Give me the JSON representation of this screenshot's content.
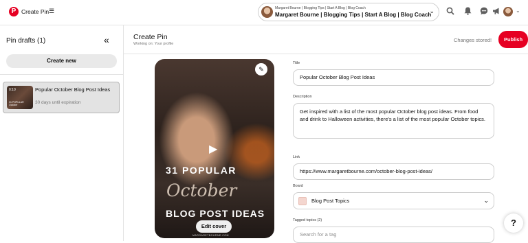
{
  "topbar": {
    "app_title": "Create Pin",
    "profile_line1": "Margaret Bourne | Blogging Tips | Start A Blog | Blog Coach",
    "profile_line2": "Margaret Bourne | Blogging Tips | Start A Blog | Blog Coach",
    "icons": [
      "pinterest-logo-icon",
      "menu-icon",
      "chevron-down-icon",
      "search-icon",
      "bell-icon",
      "chat-icon",
      "megaphone-icon",
      "avatar",
      "chevron-down-icon"
    ]
  },
  "sidebar": {
    "title": "Pin drafts",
    "count": "(1)",
    "create_new": "Create new",
    "draft": {
      "duration": "0:10",
      "title": "Popular October Blog Post Ideas",
      "subtitle": "30 days until expiration"
    }
  },
  "main": {
    "title": "Create Pin",
    "subtitle": "Working on: Your profile",
    "status": "Changes stored!",
    "publish": "Publish"
  },
  "preview": {
    "line1": "31 POPULAR",
    "line2": "October",
    "line3": "BLOG POST IDEAS",
    "edit_cover": "Edit cover",
    "url": "MARGARETBOURNE.COM"
  },
  "form": {
    "title_label": "Title",
    "title_value": "Popular October Blog Post Ideas",
    "description_label": "Description",
    "description_value": "Get inspired with a list of the most popular October blog post ideas. From food and drink to Halloween activities, there's a list of the most popular October topics.",
    "link_label": "Link",
    "link_value": "https://www.margaretbourne.com/october-blog-post-ideas/",
    "board_label": "Board",
    "board_value": "Blog Post Topics",
    "tags_label": "Tagged topics (2)",
    "tags_placeholder": "Search for a tag"
  },
  "help": "?",
  "colors": {
    "brand": "#e60023",
    "border": "#cdcdcd",
    "muted": "#767676"
  }
}
